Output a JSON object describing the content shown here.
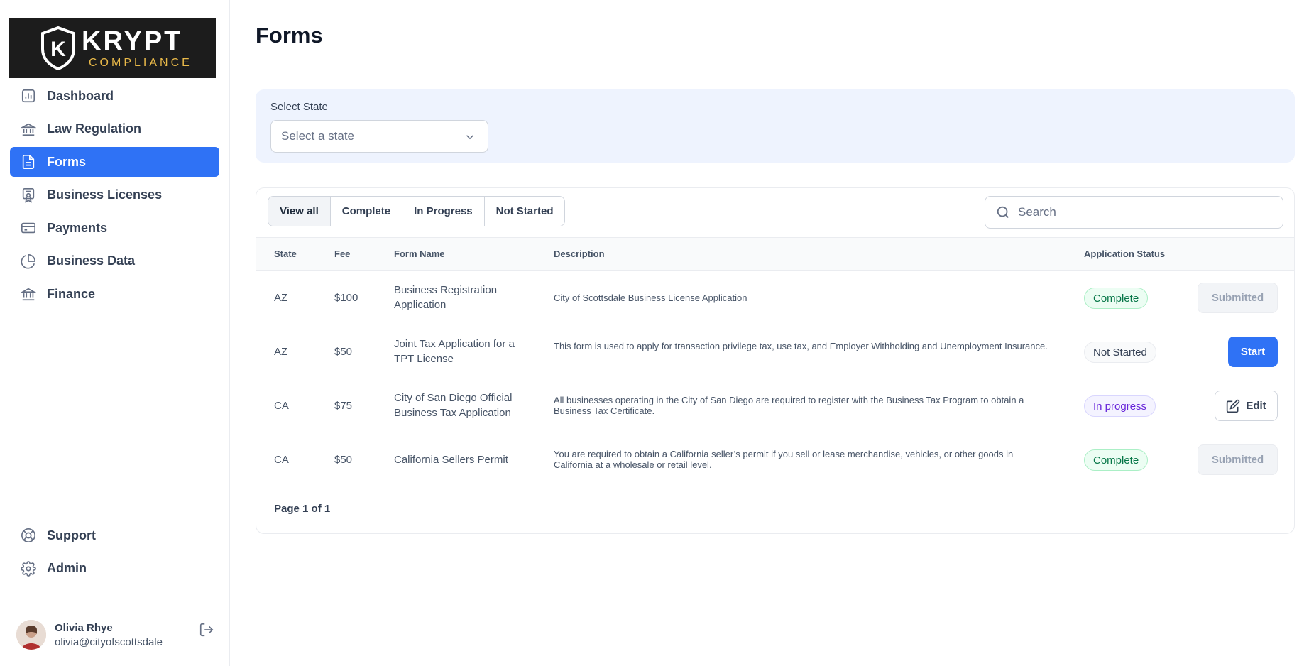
{
  "brand": {
    "logo_letter": "K",
    "name": "KRYPT",
    "tagline": "COMPLIANCE",
    "colors": {
      "logo_bg": "#1c1c1c",
      "gold": "#e9b949",
      "accent": "#2f72f5"
    }
  },
  "sidebar": {
    "items": [
      {
        "label": "Dashboard",
        "icon": "bar-chart-icon"
      },
      {
        "label": "Law Regulation",
        "icon": "bank-icon"
      },
      {
        "label": "Forms",
        "icon": "file-text-icon",
        "active": true
      },
      {
        "label": "Business Licenses",
        "icon": "certificate-icon"
      },
      {
        "label": "Payments",
        "icon": "credit-card-icon"
      },
      {
        "label": "Business Data",
        "icon": "pie-chart-icon"
      },
      {
        "label": "Finance",
        "icon": "bank-icon"
      }
    ],
    "bottom_items": [
      {
        "label": "Support",
        "icon": "life-buoy-icon"
      },
      {
        "label": "Admin",
        "icon": "gear-icon"
      }
    ],
    "user": {
      "name": "Olivia Rhye",
      "email": "olivia@cityofscottsdale"
    }
  },
  "page": {
    "title": "Forms"
  },
  "filter": {
    "label": "Select State",
    "placeholder": "Select a state"
  },
  "tabs": [
    {
      "label": "View all",
      "active": true
    },
    {
      "label": "Complete"
    },
    {
      "label": "In Progress"
    },
    {
      "label": "Not Started"
    }
  ],
  "search": {
    "placeholder": "Search"
  },
  "table": {
    "headers": {
      "state": "State",
      "fee": "Fee",
      "form_name": "Form Name",
      "description": "Description",
      "status": "Application Status"
    },
    "rows": [
      {
        "state": "AZ",
        "fee": "$100",
        "form_name": "Business Registration Application",
        "description": "City of Scottsdale Business License Application",
        "status": "Complete",
        "action": "Submitted"
      },
      {
        "state": "AZ",
        "fee": "$50",
        "form_name": "Joint Tax Application for a TPT License",
        "description": "This form is used to apply for transaction privilege tax, use tax, and Employer Withholding and Unemployment Insurance.",
        "status": "Not Started",
        "action": "Start"
      },
      {
        "state": "CA",
        "fee": "$75",
        "form_name": "City of San Diego Official Business Tax Application",
        "description": "All businesses operating in the City of San Diego are required to register with the Business Tax Program to obtain a Business Tax Certificate.",
        "status": "In progress",
        "action": "Edit"
      },
      {
        "state": "CA",
        "fee": "$50",
        "form_name": "California Sellers Permit",
        "description": "You are required to obtain a California seller’s permit if you sell or lease merchandise, vehicles, or other goods in California at a wholesale or retail level.",
        "status": "Complete",
        "action": "Submitted"
      }
    ]
  },
  "pagination": {
    "text": "Page 1 of 1"
  }
}
